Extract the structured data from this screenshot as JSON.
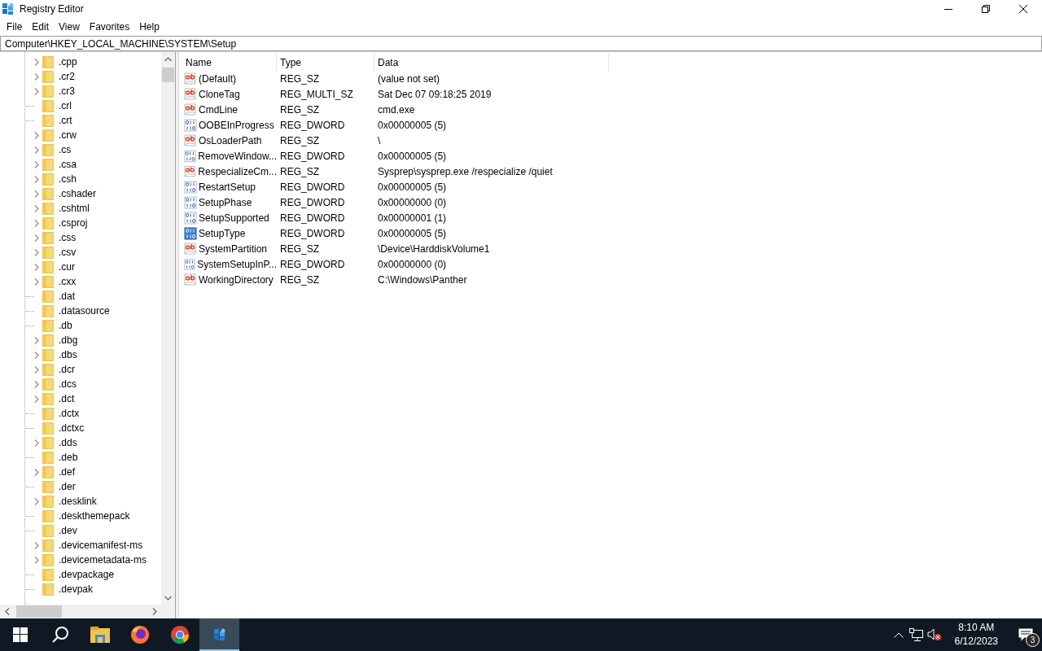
{
  "window": {
    "title": "Registry Editor"
  },
  "menu": [
    "File",
    "Edit",
    "View",
    "Favorites",
    "Help"
  ],
  "address": "Computer\\HKEY_LOCAL_MACHINE\\SYSTEM\\Setup",
  "tree": [
    {
      "label": ".cpp",
      "expandable": true
    },
    {
      "label": ".cr2",
      "expandable": true
    },
    {
      "label": ".cr3",
      "expandable": true
    },
    {
      "label": ".crl",
      "expandable": false
    },
    {
      "label": ".crt",
      "expandable": false
    },
    {
      "label": ".crw",
      "expandable": true
    },
    {
      "label": ".cs",
      "expandable": true
    },
    {
      "label": ".csa",
      "expandable": true
    },
    {
      "label": ".csh",
      "expandable": true
    },
    {
      "label": ".cshader",
      "expandable": true
    },
    {
      "label": ".cshtml",
      "expandable": true
    },
    {
      "label": ".csproj",
      "expandable": true
    },
    {
      "label": ".css",
      "expandable": true
    },
    {
      "label": ".csv",
      "expandable": true
    },
    {
      "label": ".cur",
      "expandable": true
    },
    {
      "label": ".cxx",
      "expandable": true
    },
    {
      "label": ".dat",
      "expandable": false
    },
    {
      "label": ".datasource",
      "expandable": false
    },
    {
      "label": ".db",
      "expandable": false
    },
    {
      "label": ".dbg",
      "expandable": true
    },
    {
      "label": ".dbs",
      "expandable": true
    },
    {
      "label": ".dcr",
      "expandable": true
    },
    {
      "label": ".dcs",
      "expandable": true
    },
    {
      "label": ".dct",
      "expandable": true
    },
    {
      "label": ".dctx",
      "expandable": false
    },
    {
      "label": ".dctxc",
      "expandable": false
    },
    {
      "label": ".dds",
      "expandable": true
    },
    {
      "label": ".deb",
      "expandable": false
    },
    {
      "label": ".def",
      "expandable": true
    },
    {
      "label": ".der",
      "expandable": false
    },
    {
      "label": ".desklink",
      "expandable": true
    },
    {
      "label": ".deskthemepack",
      "expandable": false
    },
    {
      "label": ".dev",
      "expandable": false
    },
    {
      "label": ".devicemanifest-ms",
      "expandable": true
    },
    {
      "label": ".devicemetadata-ms",
      "expandable": true
    },
    {
      "label": ".devpackage",
      "expandable": false
    },
    {
      "label": ".devpak",
      "expandable": false
    }
  ],
  "table": {
    "columns": [
      "Name",
      "Type",
      "Data"
    ],
    "rows": [
      {
        "kind": "string",
        "name": "(Default)",
        "type": "REG_SZ",
        "data": "(value not set)",
        "selected": false
      },
      {
        "kind": "string",
        "name": "CloneTag",
        "type": "REG_MULTI_SZ",
        "data": "Sat Dec 07 09:18:25 2019",
        "selected": false
      },
      {
        "kind": "string",
        "name": "CmdLine",
        "type": "REG_SZ",
        "data": "cmd.exe",
        "selected": false
      },
      {
        "kind": "dword",
        "name": "OOBEInProgress",
        "type": "REG_DWORD",
        "data": "0x00000005 (5)",
        "selected": false
      },
      {
        "kind": "string",
        "name": "OsLoaderPath",
        "type": "REG_SZ",
        "data": "\\",
        "selected": false
      },
      {
        "kind": "dword",
        "name": "RemoveWindow...",
        "type": "REG_DWORD",
        "data": "0x00000005 (5)",
        "selected": false
      },
      {
        "kind": "string",
        "name": "RespecializeCm...",
        "type": "REG_SZ",
        "data": "Sysprep\\sysprep.exe /respecialize /quiet",
        "selected": false
      },
      {
        "kind": "dword",
        "name": "RestartSetup",
        "type": "REG_DWORD",
        "data": "0x00000005 (5)",
        "selected": false
      },
      {
        "kind": "dword",
        "name": "SetupPhase",
        "type": "REG_DWORD",
        "data": "0x00000000 (0)",
        "selected": false
      },
      {
        "kind": "dword",
        "name": "SetupSupported",
        "type": "REG_DWORD",
        "data": "0x00000001 (1)",
        "selected": false
      },
      {
        "kind": "dword",
        "name": "SetupType",
        "type": "REG_DWORD",
        "data": "0x00000005 (5)",
        "selected": true
      },
      {
        "kind": "string",
        "name": "SystemPartition",
        "type": "REG_SZ",
        "data": "\\Device\\HarddiskVolume1",
        "selected": false
      },
      {
        "kind": "dword",
        "name": "SystemSetupInP...",
        "type": "REG_DWORD",
        "data": "0x00000000 (0)",
        "selected": false
      },
      {
        "kind": "string",
        "name": "WorkingDirectory",
        "type": "REG_SZ",
        "data": "C:\\Windows\\Panther",
        "selected": false
      }
    ]
  },
  "taskbar": {
    "apps": [
      {
        "kind": "explorer",
        "selected": false
      },
      {
        "kind": "firefox",
        "selected": false
      },
      {
        "kind": "chrome",
        "selected": false
      },
      {
        "kind": "regedit",
        "selected": true
      }
    ],
    "time": "8:10 AM",
    "date": "6/12/2023",
    "notifications": "3"
  }
}
